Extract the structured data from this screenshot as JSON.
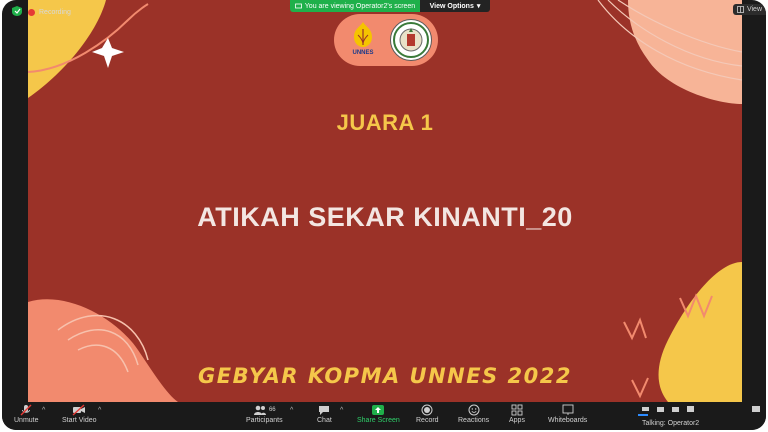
{
  "topbar": {
    "recording_label": "Recording",
    "viewing_label": "You are viewing Operator2's screen",
    "view_options_label": "View Options",
    "view_button_label": "View"
  },
  "slide": {
    "badge_text": "UNNES",
    "title": "JUARA 1",
    "name": "ATIKAH SEKAR KINANTI_20",
    "footer": "GEBYAR KOPMA UNNES 2022"
  },
  "toolbar": {
    "unmute_label": "Unmute",
    "start_video_label": "Start Video",
    "participants_label": "Participants",
    "participants_count": "66",
    "chat_label": "Chat",
    "share_label": "Share Screen",
    "record_label": "Record",
    "reactions_label": "Reactions",
    "apps_label": "Apps",
    "whiteboards_label": "Whiteboards"
  },
  "status": {
    "talking": "Talking: Operator2"
  },
  "colors": {
    "slide_bg": "#9b3228",
    "accent_yellow": "#f5c74a",
    "coral": "#f28a6e",
    "zoom_green": "#1fb04a"
  }
}
